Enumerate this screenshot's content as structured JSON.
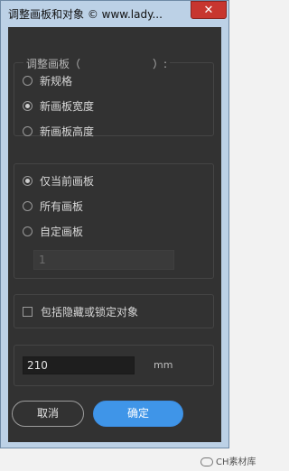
{
  "window": {
    "title": "调整画板和对象 © www.lady...",
    "close_label": "✕"
  },
  "resize_group": {
    "legend": "调整画板（",
    "legend_tail": "）:",
    "options": [
      {
        "label": "新规格",
        "selected": false
      },
      {
        "label": "新画板宽度",
        "selected": true
      },
      {
        "label": "新画板高度",
        "selected": false
      }
    ]
  },
  "scope_group": {
    "options": [
      {
        "label": "仅当前画板",
        "selected": true
      },
      {
        "label": "所有画板",
        "selected": false
      },
      {
        "label": "自定画板",
        "selected": false
      }
    ],
    "custom_value": "1"
  },
  "include_hidden": {
    "label": "包括隐藏或锁定对象",
    "checked": false
  },
  "size": {
    "value": "210",
    "unit": "mm"
  },
  "buttons": {
    "cancel": "取消",
    "ok": "确定"
  },
  "watermark": "CH素材库"
}
